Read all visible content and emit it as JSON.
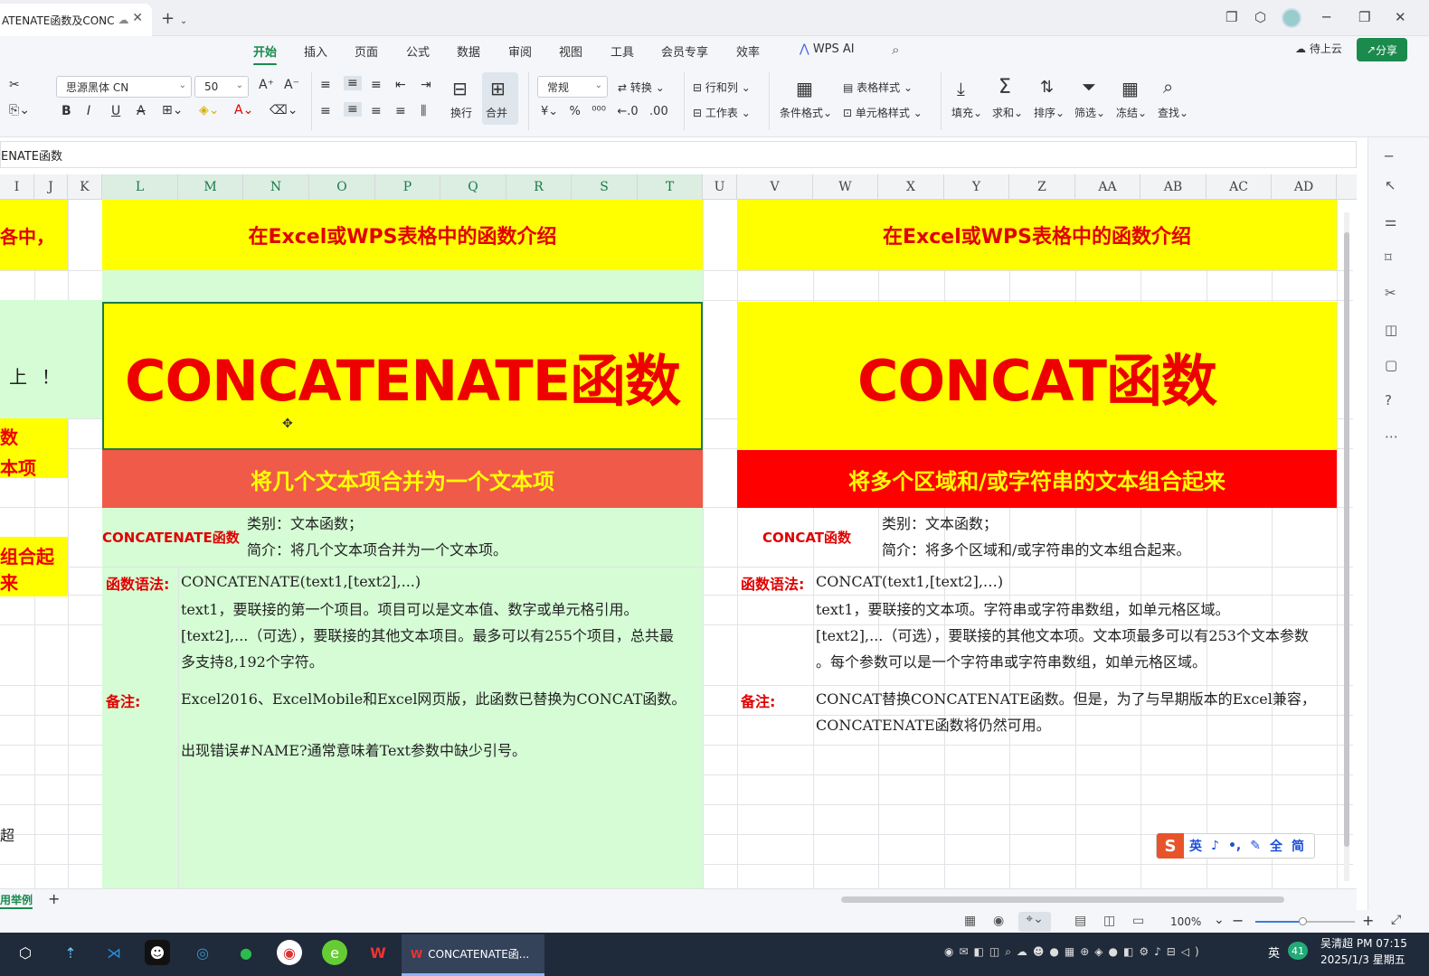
{
  "window": {
    "doc_tab": "ATENATE函数及CONC",
    "new_tab": "+"
  },
  "ribbon": {
    "tabs": [
      "开始",
      "插入",
      "页面",
      "公式",
      "数据",
      "审阅",
      "视图",
      "工具",
      "会员专享",
      "效率",
      "WPS AI"
    ],
    "cloud": "待上云",
    "share": "分享"
  },
  "toolbar": {
    "font_name": "思源黑体 CN",
    "font_size": "50",
    "wrap": "换行",
    "merge": "合并",
    "number_format": "常规",
    "convert": "转换",
    "rowcol": "行和列",
    "worksheet": "工作表",
    "cond_format": "条件格式",
    "table_style": "表格样式",
    "cell_style": "单元格样式",
    "fill": "填充",
    "sum": "求和",
    "sort": "排序",
    "filter": "筛选",
    "freeze": "冻结",
    "find": "查找"
  },
  "formula_bar": {
    "content": "ENATE函数"
  },
  "columns": [
    "I",
    "J",
    "K",
    "L",
    "M",
    "N",
    "O",
    "P",
    "Q",
    "R",
    "S",
    "T",
    "U",
    "V",
    "W",
    "X",
    "Y",
    "Z",
    "AA",
    "AB",
    "AC",
    "AD"
  ],
  "sheet": {
    "left_fragments": [
      "各中，",
      "上",
      "！",
      "数",
      "本项",
      "组合起来",
      "超"
    ],
    "header_left": "在Excel或WPS表格中的函数介绍",
    "header_right": "在Excel或WPS表格中的函数介绍",
    "title_left": "CONCATENATE函数",
    "title_right": "CONCAT函数",
    "subtitle_left": "将几个文本项合并为一个文本项",
    "subtitle_right": "将多个区域和/或字符串的文本组合起来",
    "left": {
      "fn_label": "CONCATENATE函数",
      "category": "类别：文本函数；",
      "intro": "简介：将几个文本项合并为一个文本项。",
      "syntax_label": "函数语法:",
      "syntax": "CONCATENATE(text1,[text2],...)",
      "arg1": "text1，要联接的第一个项目。项目可以是文本值、数字或单元格引用。",
      "arg2a": "[text2],...（可选），要联接的其他文本项目。最多可以有255个项目，总共最",
      "arg2b": "多支持8,192个字符。",
      "note_label": "备注:",
      "note1": "Excel2016、ExcelMobile和Excel网页版，此函数已替换为CONCAT函数。",
      "note2": "出现错误#NAME?通常意味着Text参数中缺少引号。"
    },
    "right": {
      "fn_label": "CONCAT函数",
      "category": "类别：文本函数；",
      "intro": "简介：将多个区域和/或字符串的文本组合起来。",
      "syntax_label": "函数语法:",
      "syntax": "CONCAT(text1,[text2],…)",
      "arg1": "text1，要联接的文本项。字符串或字符串数组，如单元格区域。",
      "arg2a": "[text2],...（可选），要联接的其他文本项。文本项最多可以有253个文本参数",
      "arg2b": "。每个参数可以是一个字符串或字符串数组，如单元格区域。",
      "note_label": "备注:",
      "note1": "CONCAT替换CONCATENATE函数。但是，为了与早期版本的Excel兼容，",
      "note2": "CONCATENATE函数将仍然可用。"
    }
  },
  "sheet_tab": "用举例",
  "status": {
    "zoom": "100%"
  },
  "ime": {
    "items": [
      "英",
      "♪",
      "•,",
      "✎",
      "全",
      "简"
    ]
  },
  "taskbar": {
    "active_app": "CONCATENATE函...",
    "tray_lang": "英",
    "badge": "41",
    "user": "吴清超",
    "time": "PM 07:15",
    "date": "2025/1/3 星期五"
  }
}
